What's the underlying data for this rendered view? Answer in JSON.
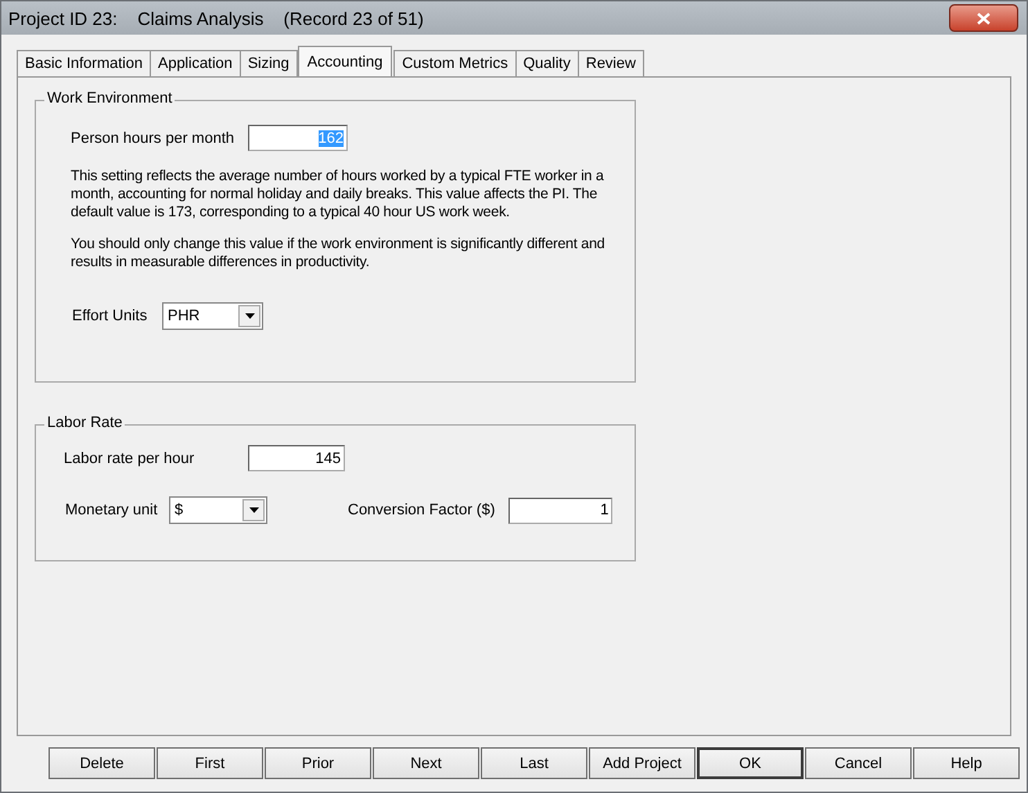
{
  "window": {
    "title": "Project ID 23:    Claims Analysis    (Record 23 of 51)"
  },
  "tabs": [
    {
      "label": "Basic Information",
      "selected": false
    },
    {
      "label": "Application",
      "selected": false
    },
    {
      "label": "Sizing",
      "selected": false
    },
    {
      "label": "Accounting",
      "selected": true
    },
    {
      "label": "Custom Metrics",
      "selected": false
    },
    {
      "label": "Quality",
      "selected": false
    },
    {
      "label": "Review",
      "selected": false
    }
  ],
  "work_environment": {
    "title": "Work Environment",
    "person_hours": {
      "label": "Person hours per month",
      "value": "162",
      "text_selected": true
    },
    "paragraphs": [
      "This setting reflects the average number of hours worked by a typical FTE worker in a month, accounting for normal holiday and daily breaks.  This value affects the PI.  The default value is 173, corresponding to a typical 40 hour US work week.",
      "You should only change this value if the work environment is significantly different and results in measurable differences in productivity."
    ],
    "effort_units": {
      "label": "Effort Units",
      "value": "PHR"
    }
  },
  "labor_rate": {
    "title": "Labor Rate",
    "rate": {
      "label": "Labor rate per hour",
      "value": "145"
    },
    "monetary_unit": {
      "label": "Monetary unit",
      "value": "$"
    },
    "conversion": {
      "label": "Conversion Factor ($)",
      "value": "1"
    }
  },
  "buttons": [
    {
      "label": "Delete",
      "default": false
    },
    {
      "label": "First",
      "default": false
    },
    {
      "label": "Prior",
      "default": false
    },
    {
      "label": "Next",
      "default": false
    },
    {
      "label": "Last",
      "default": false
    },
    {
      "label": "Add Project",
      "default": false
    },
    {
      "label": "OK",
      "default": true
    },
    {
      "label": "Cancel",
      "default": false
    },
    {
      "label": "Help",
      "default": false
    }
  ]
}
